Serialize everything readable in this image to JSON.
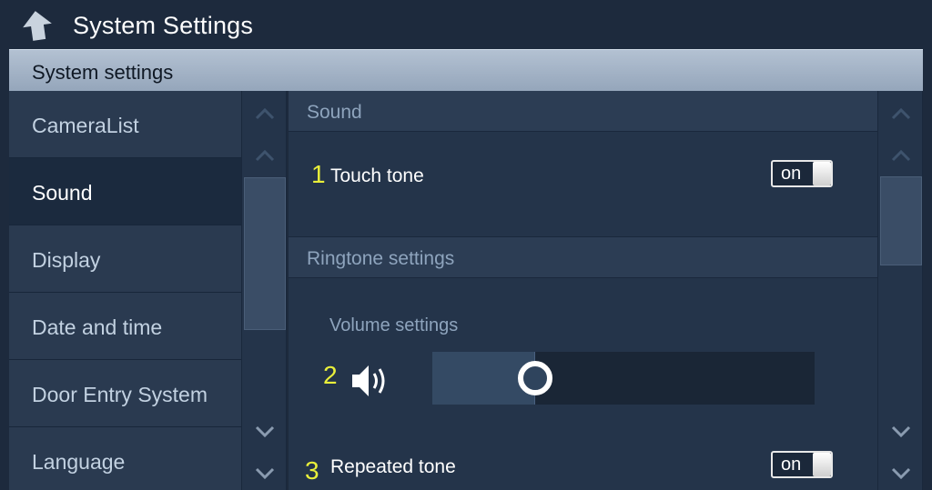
{
  "window": {
    "title": "System Settings",
    "back_icon": "back-arrow-icon"
  },
  "panel": {
    "title": "System settings"
  },
  "sidebar": {
    "items": [
      {
        "label": "CameraList",
        "active": false
      },
      {
        "label": "Sound",
        "active": true
      },
      {
        "label": "Display",
        "active": false
      },
      {
        "label": "Date and time",
        "active": false
      },
      {
        "label": "Door Entry System",
        "active": false
      },
      {
        "label": "Language",
        "active": false
      }
    ]
  },
  "sound": {
    "section_title": "Sound",
    "touch_tone": {
      "number": "1",
      "label": "Touch tone",
      "toggle": "on"
    },
    "ringtone_section_title": "Ringtone settings",
    "volume": {
      "label": "Volume settings",
      "number": "2",
      "icon": "speaker-icon",
      "level": 0.27
    },
    "repeated_tone": {
      "number": "3",
      "label": "Repeated tone",
      "toggle": "on"
    }
  },
  "colors": {
    "annotation": "#e9ef3a",
    "background": "#1d2a3d",
    "header": "#a6b6c8"
  }
}
